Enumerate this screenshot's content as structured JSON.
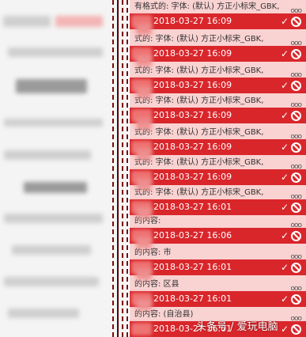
{
  "comments": [
    {
      "text": "有格式的: 字体: (默认) 方正小标宋_GBK,",
      "date": "2018-03-27 16:09"
    },
    {
      "text": "式的: 字体: (默认) 方正小标宋_GBK,",
      "date": "2018-03-27 16:09"
    },
    {
      "text": "式的: 字体: (默认) 方正小标宋_GBK,",
      "date": "2018-03-27 16:09"
    },
    {
      "text": "式的: 字体: (默认) 方正小标宋_GBK,",
      "date": "2018-03-27 16:09"
    },
    {
      "text": "式的: 字体: (默认) 方正小标宋_GBK,",
      "date": "2018-03-27 16:09"
    },
    {
      "text": "式的: 字体: (默认) 方正小标宋_GBK,",
      "date": "2018-03-27 16:09"
    },
    {
      "text": "式的: 字体: (默认) 方正小标宋_GBK,",
      "date": "2018-03-27 16:01"
    },
    {
      "text": "的内容:",
      "date": "2018-03-27 16:06"
    },
    {
      "text": "的内容: 市",
      "date": "2018-03-27 16:01"
    },
    {
      "text": "的内容: 区县",
      "date": "2018-03-27 16:01"
    },
    {
      "text": "的内容: (自治县)",
      "date": "2018-03-27 16:01"
    }
  ],
  "more_label": "ooo",
  "accept_glyph": "✓",
  "watermark": "头条号 / 爱玩电脑"
}
